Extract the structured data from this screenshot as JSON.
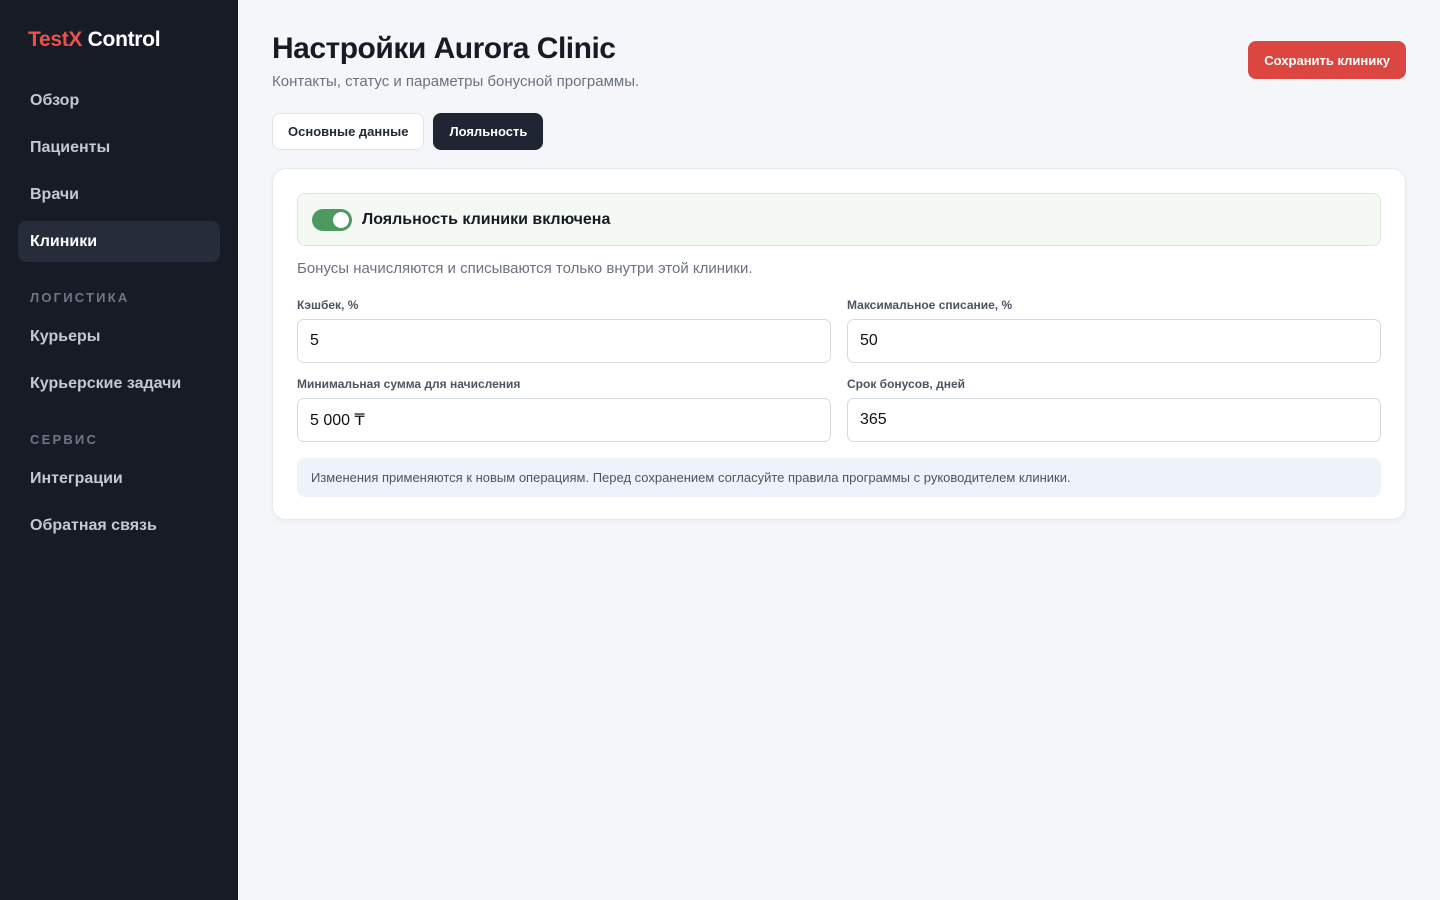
{
  "brand": {
    "part1": "TestX",
    "part2": " Control"
  },
  "sidebar": {
    "items_main": [
      {
        "label": "Обзор",
        "active": false
      },
      {
        "label": "Пациенты",
        "active": false
      },
      {
        "label": "Врачи",
        "active": false
      },
      {
        "label": "Клиники",
        "active": true
      }
    ],
    "section_logistics": "Логистика",
    "items_logistics": [
      {
        "label": "Курьеры"
      },
      {
        "label": "Курьерские задачи"
      }
    ],
    "section_service": "Сервис",
    "items_service": [
      {
        "label": "Интеграции"
      },
      {
        "label": "Обратная связь"
      }
    ]
  },
  "header": {
    "title": "Настройки Aurora Clinic",
    "subtitle": "Контакты, статус и параметры бонусной программы.",
    "save_label": "Сохранить клинику"
  },
  "tabs": [
    {
      "label": "Основные данные",
      "active": false
    },
    {
      "label": "Лояльность",
      "active": true
    }
  ],
  "loyalty": {
    "toggle_label": "Лояльность клиники включена",
    "toggle_on": true,
    "help_text": "Бонусы начисляются и списываются только внутри этой клиники.",
    "fields": {
      "cashback": {
        "label": "Кэшбек, %",
        "value": "5"
      },
      "max_writeoff": {
        "label": "Максимальное списание, %",
        "value": "50"
      },
      "min_amount": {
        "label": "Минимальная сумма для начисления",
        "value": "5 000 ₸"
      },
      "bonus_term": {
        "label": "Срок бонусов, дней",
        "value": "365"
      }
    },
    "notice": "Изменения применяются к новым операциям. Перед сохранением согласуйте правила программы с руководителем клиники."
  },
  "colors": {
    "accent_red": "#dc4641",
    "sidebar_bg": "#161b26",
    "toggle_green": "#4c9a5f"
  }
}
